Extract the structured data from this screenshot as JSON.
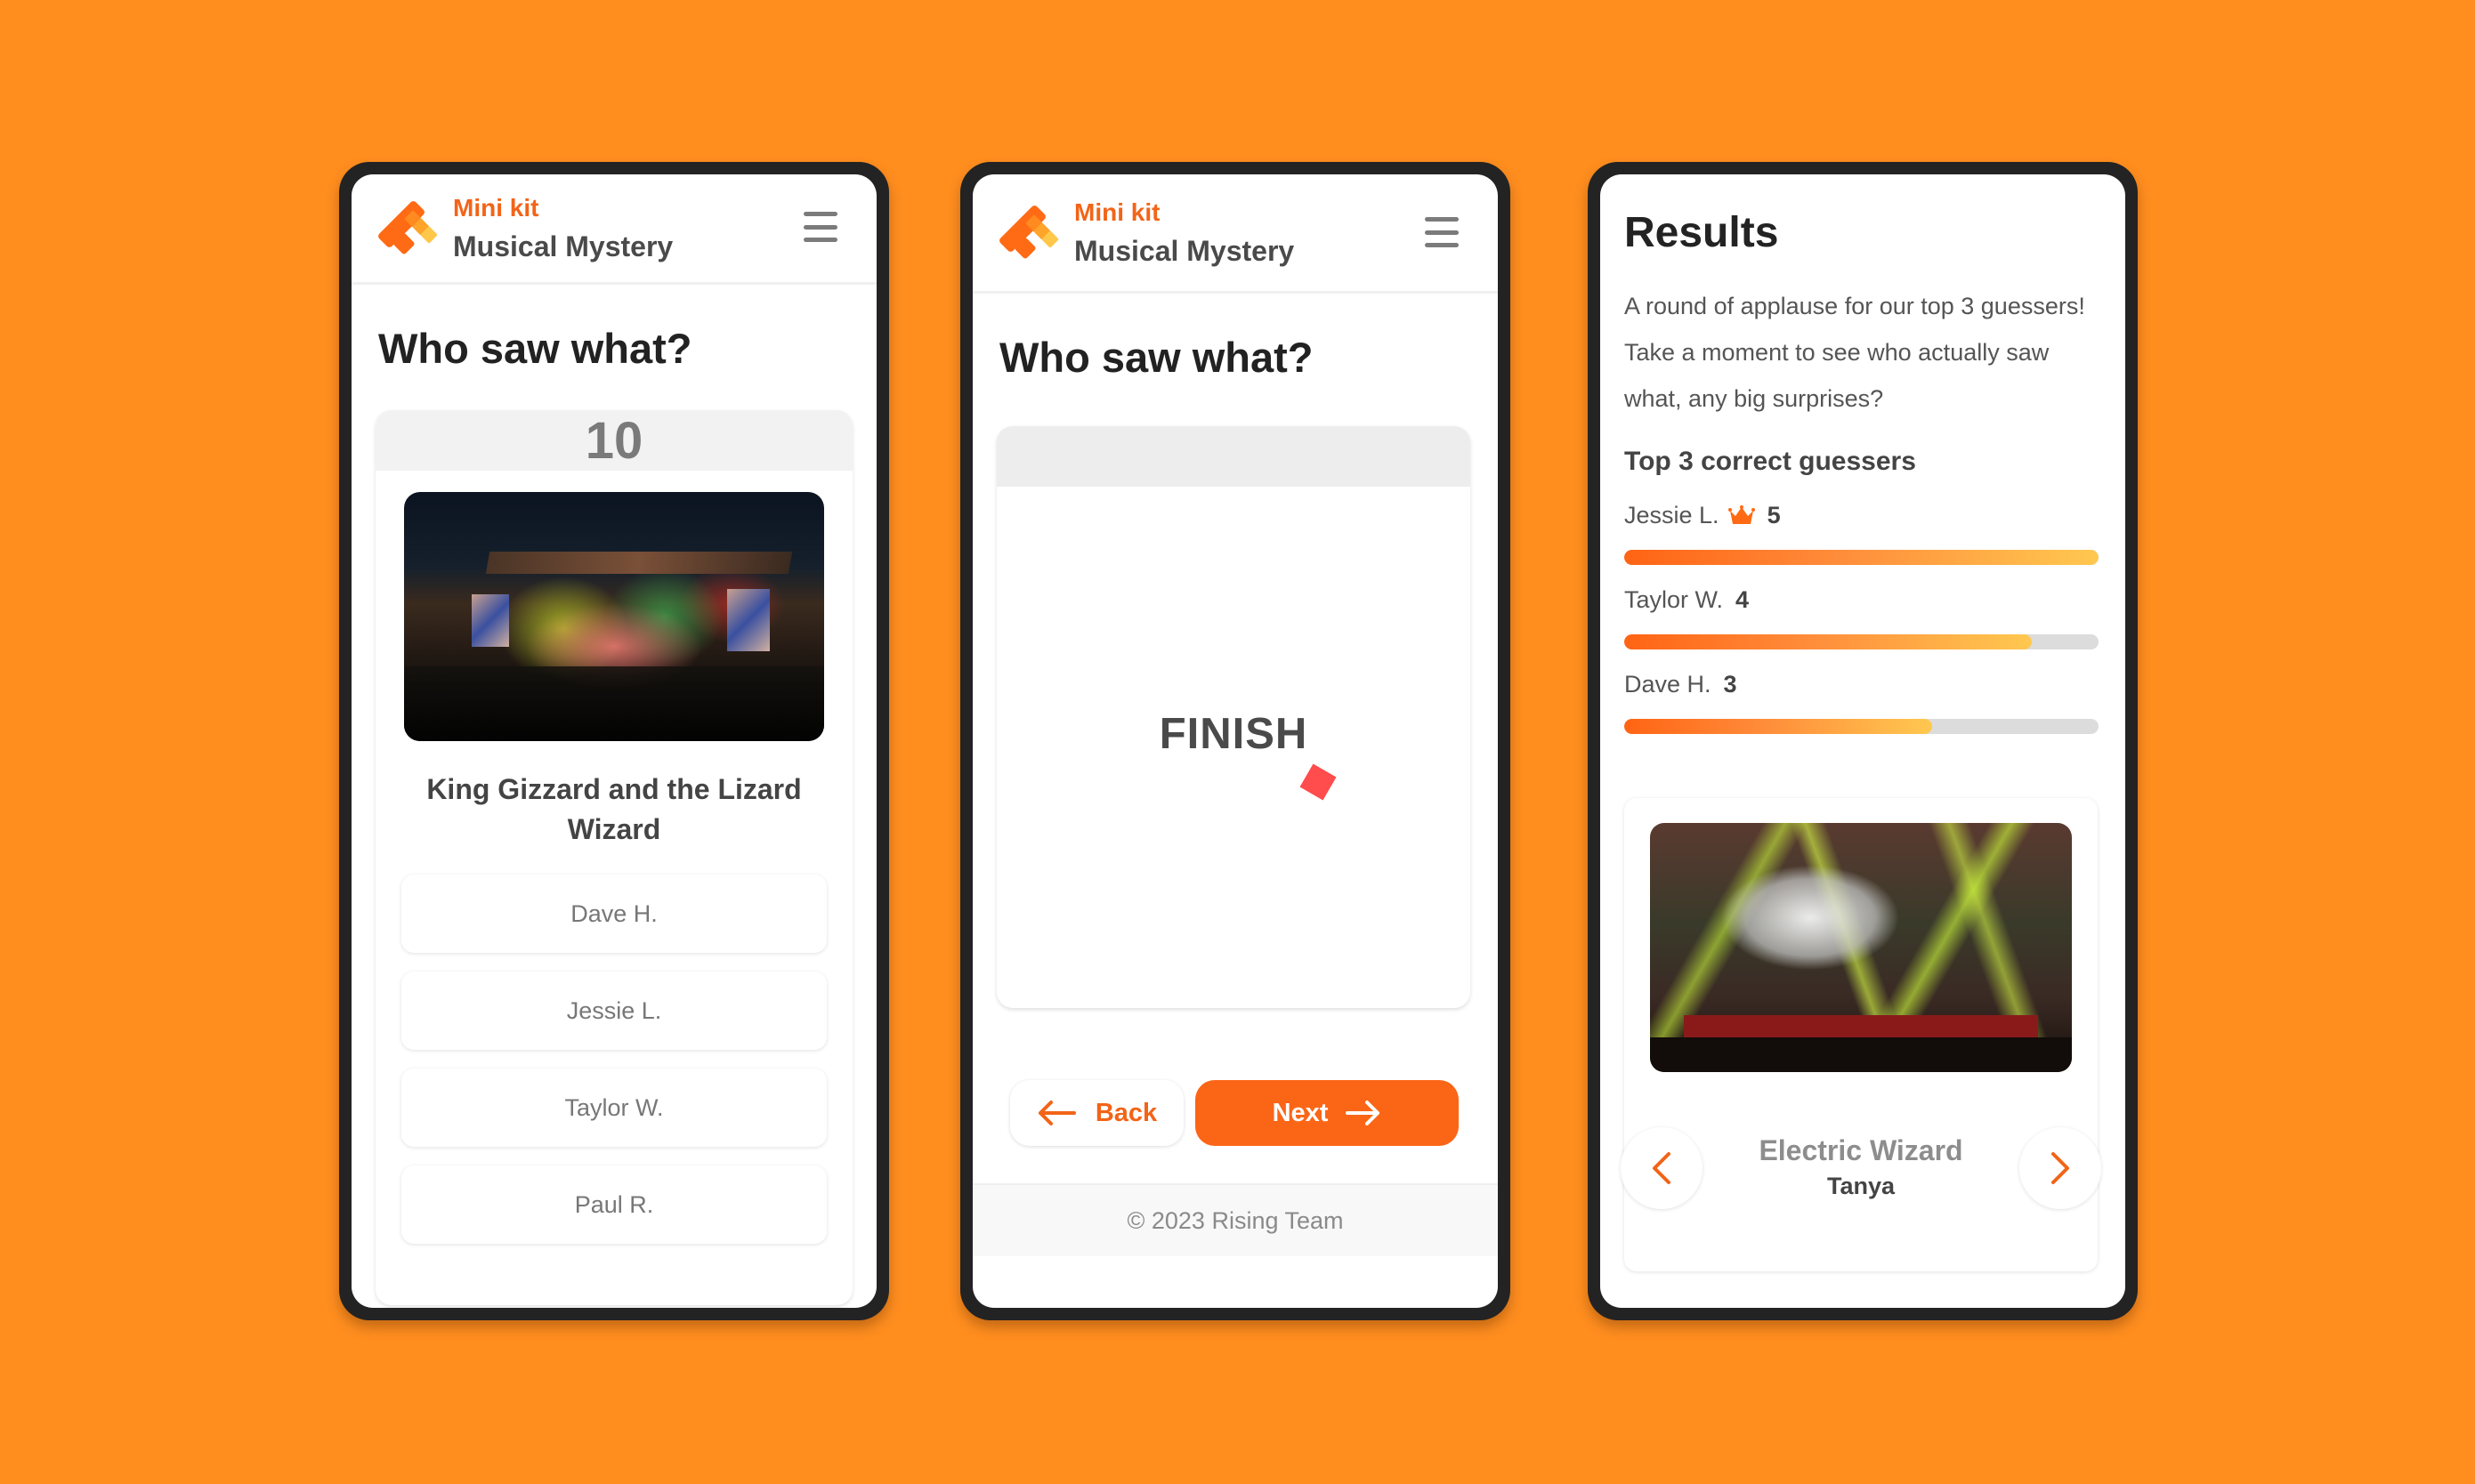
{
  "app": {
    "kit_label": "Mini kit",
    "app_name": "Musical Mystery",
    "brand_color": "#F26418",
    "background_color": "#FF8E1F"
  },
  "screen1": {
    "title": "Who saw what?",
    "countdown": "10",
    "image_alt": "concert-stage-photo",
    "band_name": "King Gizzard and the Lizard Wizard",
    "options": [
      {
        "label": "Dave H."
      },
      {
        "label": "Jessie L."
      },
      {
        "label": "Taylor W."
      },
      {
        "label": "Paul R."
      }
    ]
  },
  "screen2": {
    "title": "Who saw what?",
    "finish_label": "FINISH",
    "back_label": "Back",
    "next_label": "Next",
    "footer": "© 2023 Rising Team"
  },
  "screen3": {
    "title": "Results",
    "description": "A round of applause for our top 3 guessers! Take a moment to see who actually saw what, any big surprises?",
    "leaderboard_title": "Top 3 correct guessers",
    "leaders": [
      {
        "name": "Jessie L.",
        "score": "5",
        "crown": true,
        "progress_pct": 100
      },
      {
        "name": "Taylor W.",
        "score": "4",
        "crown": false,
        "progress_pct": 86
      },
      {
        "name": "Dave H.",
        "score": "3",
        "crown": false,
        "progress_pct": 65
      }
    ],
    "gallery": {
      "band_name": "Electric Wizard",
      "seen_by": "Tanya",
      "prev_icon": "chevron-left-icon",
      "next_icon": "chevron-right-icon"
    }
  }
}
